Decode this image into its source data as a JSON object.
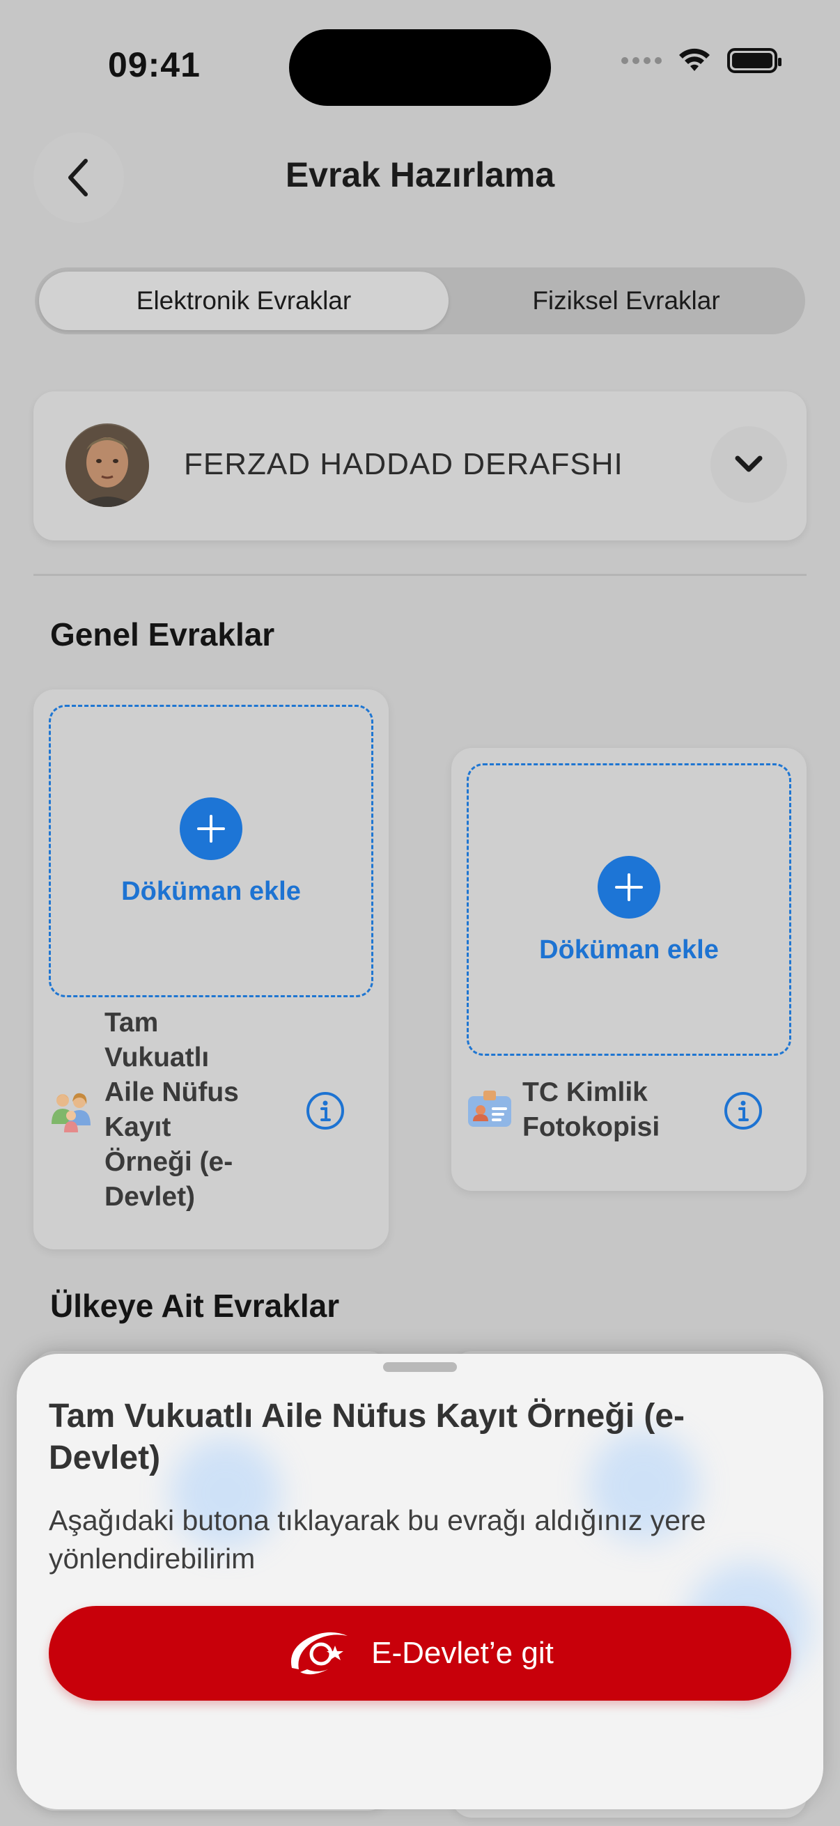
{
  "status_bar": {
    "time": "09:41"
  },
  "header": {
    "title": "Evrak Hazırlama"
  },
  "tabs": [
    {
      "label": "Elektronik Evraklar",
      "active": true
    },
    {
      "label": "Fiziksel Evraklar",
      "active": false
    }
  ],
  "profile": {
    "name": "FERZAD HADDAD DERAFSHI"
  },
  "sections": {
    "general": "Genel Evraklar",
    "country": "Ülkeye Ait Evraklar"
  },
  "documents": [
    {
      "add_label": "Döküman ekle",
      "title_lines": [
        "Tam",
        "Vukuatlı",
        "Aile Nüfus",
        "Kayıt",
        "Örneği (e-",
        "Devlet)"
      ],
      "icon": "family-icon"
    },
    {
      "add_label": "Döküman ekle",
      "title_lines": [
        "TC Kimlik",
        "Fotokopisi"
      ],
      "icon": "id-card-icon"
    }
  ],
  "sheet": {
    "title": "Tam Vukuatlı Aile Nüfus Kayıt Örneği (e-Devlet)",
    "description": "Aşağıdaki butona tıklayarak bu evrağı aldığınız yere yönlendirebilirim",
    "button_label": "E-Devlet’e git"
  },
  "colors": {
    "accent": "#1d75d6",
    "primary_red": "#c8000a"
  }
}
